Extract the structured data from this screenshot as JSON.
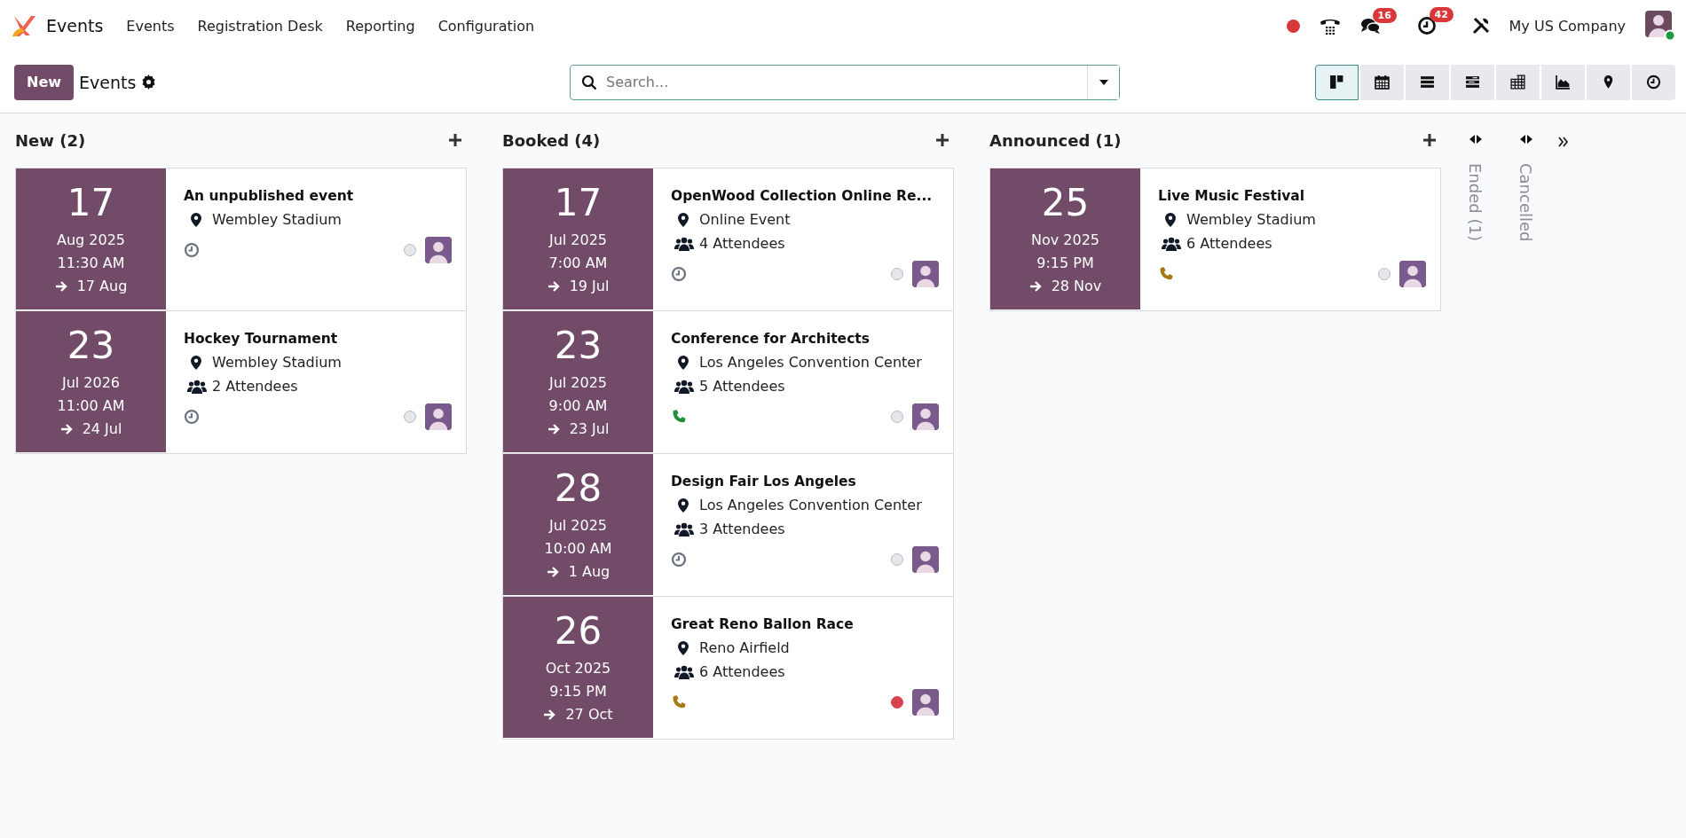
{
  "navbar": {
    "app_name": "Events",
    "menu": [
      "Events",
      "Registration Desk",
      "Reporting",
      "Configuration"
    ],
    "messages_badge": "16",
    "activities_badge": "42",
    "company": "My US Company"
  },
  "control_panel": {
    "new_button": "New",
    "title": "Events",
    "search": {
      "placeholder": "Search..."
    },
    "views": [
      {
        "kind": "kanban",
        "selected": true
      },
      {
        "kind": "calendar",
        "selected": false
      },
      {
        "kind": "list",
        "selected": false
      },
      {
        "kind": "gantt",
        "selected": false
      },
      {
        "kind": "pivot",
        "selected": false
      },
      {
        "kind": "graph",
        "selected": false
      },
      {
        "kind": "map",
        "selected": false
      },
      {
        "kind": "activity",
        "selected": false
      }
    ]
  },
  "columns": [
    {
      "title": "New (2)",
      "cards": [
        {
          "day": "17",
          "month": "Aug 2025",
          "time": "11:30 AM",
          "end": "17 Aug",
          "name": "An unpublished event",
          "location": "Wembley Stadium",
          "activity": {
            "kind": "clock"
          },
          "blocked": false
        },
        {
          "day": "23",
          "month": "Jul 2026",
          "time": "11:00 AM",
          "end": "24 Jul",
          "name": "Hockey Tournament",
          "location": "Wembley Stadium",
          "attendees": "2 Attendees",
          "activity": {
            "kind": "clock"
          },
          "blocked": false
        }
      ]
    },
    {
      "title": "Booked (4)",
      "cards": [
        {
          "day": "17",
          "month": "Jul 2025",
          "time": "7:00 AM",
          "end": "19 Jul",
          "name": "OpenWood Collection Online Re...",
          "location": "Online Event",
          "attendees": "4 Attendees",
          "activity": {
            "kind": "clock"
          },
          "blocked": false
        },
        {
          "day": "23",
          "month": "Jul 2025",
          "time": "9:00 AM",
          "end": "23 Jul",
          "name": "Conference for Architects",
          "location": "Los Angeles Convention Center",
          "attendees": "5 Attendees",
          "activity": {
            "kind": "phone",
            "color": "#1f8f3a"
          },
          "blocked": false
        },
        {
          "day": "28",
          "month": "Jul 2025",
          "time": "10:00 AM",
          "end": "1 Aug",
          "name": "Design Fair Los Angeles",
          "location": "Los Angeles Convention Center",
          "attendees": "3 Attendees",
          "activity": {
            "kind": "clock"
          },
          "blocked": false
        },
        {
          "day": "26",
          "month": "Oct 2025",
          "time": "9:15 PM",
          "end": "27 Oct",
          "name": "Great Reno Ballon Race",
          "location": "Reno Airfield",
          "attendees": "6 Attendees",
          "activity": {
            "kind": "phone",
            "color": "#a57a12"
          },
          "blocked": true
        }
      ]
    },
    {
      "title": "Announced (1)",
      "cards": [
        {
          "day": "25",
          "month": "Nov 2025",
          "time": "9:15 PM",
          "end": "28 Nov",
          "name": "Live Music Festival",
          "location": "Wembley Stadium",
          "attendees": "6 Attendees",
          "activity": {
            "kind": "phone",
            "color": "#a57a12"
          },
          "blocked": false
        }
      ]
    }
  ],
  "folded_columns": [
    "Ended (1)",
    "Cancelled"
  ]
}
